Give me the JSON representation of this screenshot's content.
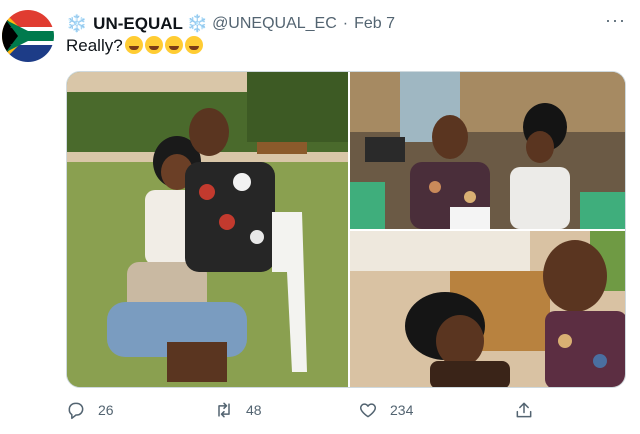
{
  "tweet": {
    "display_name": "UN-EQUAL",
    "handle": "@UNEQUAL_EC",
    "separator": "·",
    "date": "Feb 7",
    "text": "Really?",
    "emoji_count": 4,
    "snowflake": "❄️",
    "more": "···"
  },
  "actions": {
    "replies": "26",
    "retweets": "48",
    "likes": "234"
  },
  "icons": {
    "reply": "reply-icon",
    "retweet": "retweet-icon",
    "like": "heart-icon",
    "share": "share-icon"
  },
  "colors": {
    "text": "#0f1419",
    "muted": "#536471",
    "snowflake": "#5b9bd5"
  }
}
